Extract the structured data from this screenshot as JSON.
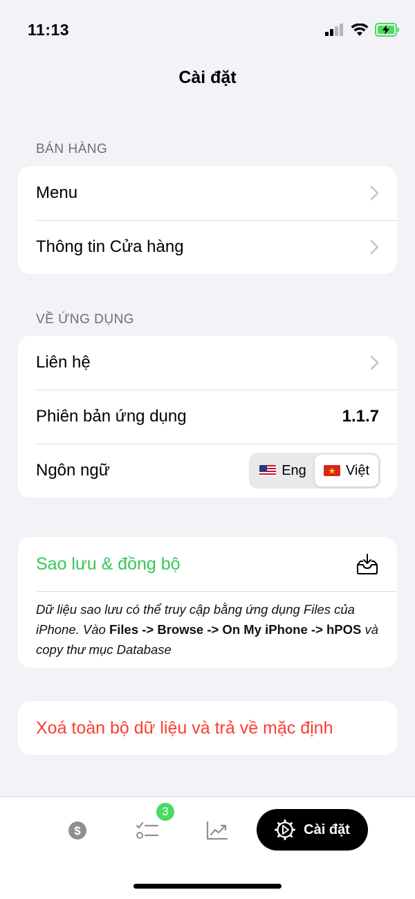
{
  "status": {
    "time": "11:13"
  },
  "header": {
    "title": "Cài đặt"
  },
  "sales_section": {
    "header": "BÁN HÀNG",
    "items": [
      {
        "label": "Menu"
      },
      {
        "label": "Thông tin Cửa hàng"
      }
    ]
  },
  "app_section": {
    "header": "VỀ ỨNG DỤNG",
    "contact_label": "Liên hệ",
    "version_label": "Phiên bản ứng dụng",
    "version_value": "1.1.7",
    "language_label": "Ngôn ngữ",
    "language_options": [
      {
        "label": "Eng",
        "flag": "us-flag",
        "selected": false
      },
      {
        "label": "Việt",
        "flag": "vn-flag",
        "selected": true
      }
    ]
  },
  "backup": {
    "title": "Sao lưu & đồng bộ",
    "note_part1": "Dữ liệu sao lưu có thể truy cập bằng ứng dụng Files của iPhone. Vào ",
    "note_bold1": "Files -> Browse -> On My iPhone -> hPOS",
    "note_part2": " và copy thư mục Database",
    "icon": "tray-download-icon",
    "color": "#34c759"
  },
  "reset": {
    "label": "Xoá toàn bộ dữ liệu và trả về mặc định",
    "color": "#ff3b30"
  },
  "tabbar": {
    "orders_badge": "3",
    "active_label": "Cài đặt"
  }
}
